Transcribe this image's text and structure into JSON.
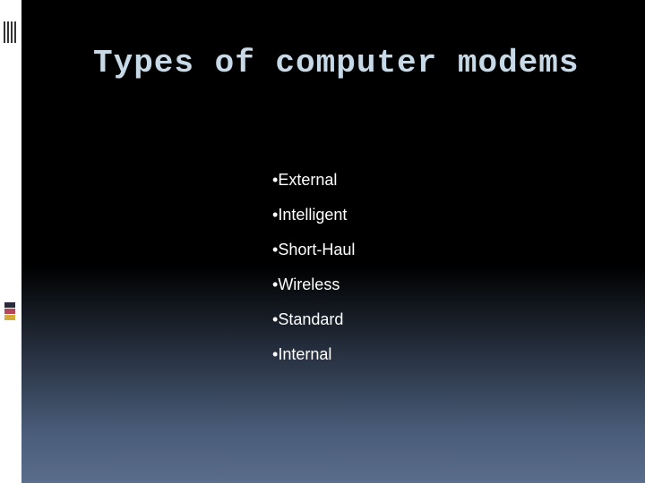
{
  "slide": {
    "title": "Types of computer modems",
    "bullets": [
      "External",
      "Intelligent",
      "Short-Haul",
      "Wireless",
      "Standard",
      "Internal"
    ]
  }
}
